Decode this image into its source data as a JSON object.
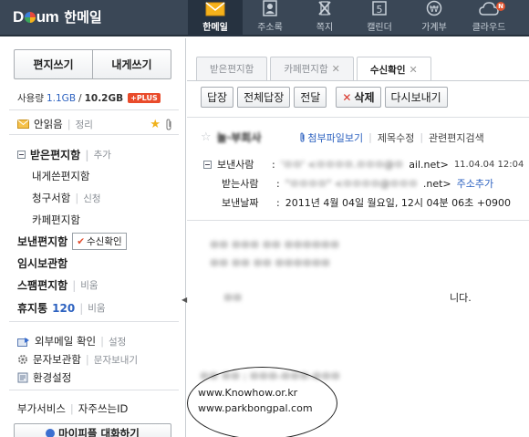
{
  "brand": {
    "logo": "Daum",
    "name": "한메일"
  },
  "apps": [
    {
      "label": "한메일",
      "icon": "mail-icon",
      "active": true
    },
    {
      "label": "주소록",
      "icon": "addressbook-icon",
      "active": false
    },
    {
      "label": "쪽지",
      "icon": "note-icon",
      "active": false
    },
    {
      "label": "캘린더",
      "icon": "calendar-icon",
      "active": false,
      "glyph": "5"
    },
    {
      "label": "가계부",
      "icon": "won-icon",
      "active": false,
      "glyph": "₩"
    },
    {
      "label": "클라우드",
      "icon": "cloud-icon",
      "active": false,
      "badge": "N"
    }
  ],
  "sidebar": {
    "compose_label": "편지쓰기",
    "self_compose_label": "내게쓰기",
    "usage": {
      "label": "사용량",
      "used": "1.1GB",
      "slash": "/",
      "total": "10.2GB",
      "plus": "+PLUS"
    },
    "unread": {
      "label": "안읽음",
      "sep": "|",
      "action": "정리"
    },
    "inbox": {
      "label": "받은편지함",
      "action": "추가"
    },
    "folders": [
      {
        "label": "내게쓴편지함",
        "action": ""
      },
      {
        "label": "청구서함",
        "action": "신청"
      },
      {
        "label": "카페편지함",
        "action": ""
      }
    ],
    "sent": {
      "label": "보낸편지함",
      "receipt_label": "수신확인"
    },
    "drafts": {
      "label": "임시보관함"
    },
    "spam": {
      "label": "스팸편지함",
      "action": "비움"
    },
    "trash": {
      "label": "휴지통",
      "count": "120",
      "action": "비움"
    },
    "external": {
      "label": "외부메일 확인",
      "action": "설정"
    },
    "sms": {
      "label": "문자보관함",
      "action": "문자보내기"
    },
    "settings": {
      "label": "환경설정"
    },
    "extra": {
      "label": "부가서비스",
      "sep": "|",
      "action": "자주쓰는ID"
    },
    "bottom_button": "마이피플 대화하기"
  },
  "tabs": [
    {
      "label": "받은편지함",
      "closable": false,
      "active": false
    },
    {
      "label": "카페편지함",
      "closable": true,
      "active": false
    },
    {
      "label": "수신확인",
      "closable": true,
      "active": true
    }
  ],
  "toolbar": {
    "reply": "답장",
    "reply_all": "전체답장",
    "forward": "전달",
    "delete": "삭제",
    "send_again": "다시보내기"
  },
  "message": {
    "subject": "놀·부회사",
    "attach_label": "첨부파일보기",
    "edit_subject": "제목수정",
    "related": "관련편지검색",
    "from_label": "보낸사람",
    "from_value": "'ㅁㅁ' <ㅁㅁㅁㅁ.ㅁㅁㅁ@ㅁ",
    "from_domain": "ail.net>",
    "from_time": "11.04.04 12:04",
    "to_label": "받는사람",
    "to_value": "\"ㅁㅁㅁㅁ\" <ㅁㅁㅁㅁ@ㅁㅁㅁ",
    "to_domain": ".net>",
    "to_action": "주소추가",
    "date_label": "보낸날짜",
    "date_value": "2011년 4월 04일 월요일, 12시 04분 06초 +0900",
    "colon": ":",
    "body": [
      "ㅁㅁ ㅁㅁㅁ ㅁㅁ ㅁㅁㅁㅁㅁㅁ",
      "ㅁㅁ ㅁㅁ ㅁㅁ ㅁㅁㅁㅁㅁㅁ",
      "ㅁㅁ"
    ],
    "body_tail": "니다.",
    "signature": {
      "blur_line": "ㅁㅁ ㅁㅁ : ㅁㅁㅁ-ㅁㅁㅁ-ㅁㅁㅁ",
      "url1": "www.Knowhow.or.kr",
      "url2": "www.parkbongpal.com"
    }
  }
}
